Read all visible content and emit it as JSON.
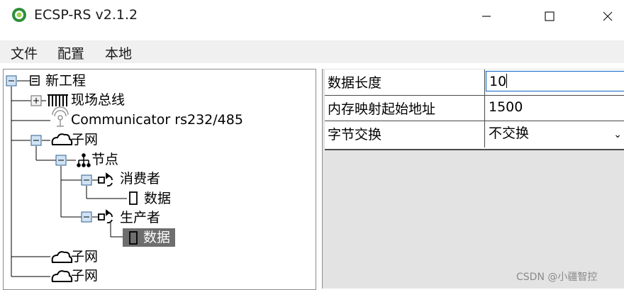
{
  "window": {
    "title": "ECSP-RS v2.1.2"
  },
  "menu": {
    "items": [
      "文件",
      "配置",
      "本地"
    ]
  },
  "tree": {
    "root": "新工程",
    "fieldbus": "现场总线",
    "communicator": "Communicator rs232/485",
    "subnet1": "子网",
    "nodes": "节点",
    "consumer": "消费者",
    "consumer_data": "数据",
    "producer": "生产者",
    "producer_data": "数据",
    "subnet2": "子网",
    "subnet3": "子网"
  },
  "properties": [
    {
      "name": "数据长度",
      "value": "10"
    },
    {
      "name": "内存映射起始地址",
      "value": "1500"
    },
    {
      "name": "字节交换",
      "value": "不交换"
    }
  ],
  "watermark": "CSDN @小疆智控",
  "colors": {
    "accent": "#0b63c5",
    "selected_bg": "#6e6e6e",
    "panel_bg": "#e3e3e3"
  }
}
